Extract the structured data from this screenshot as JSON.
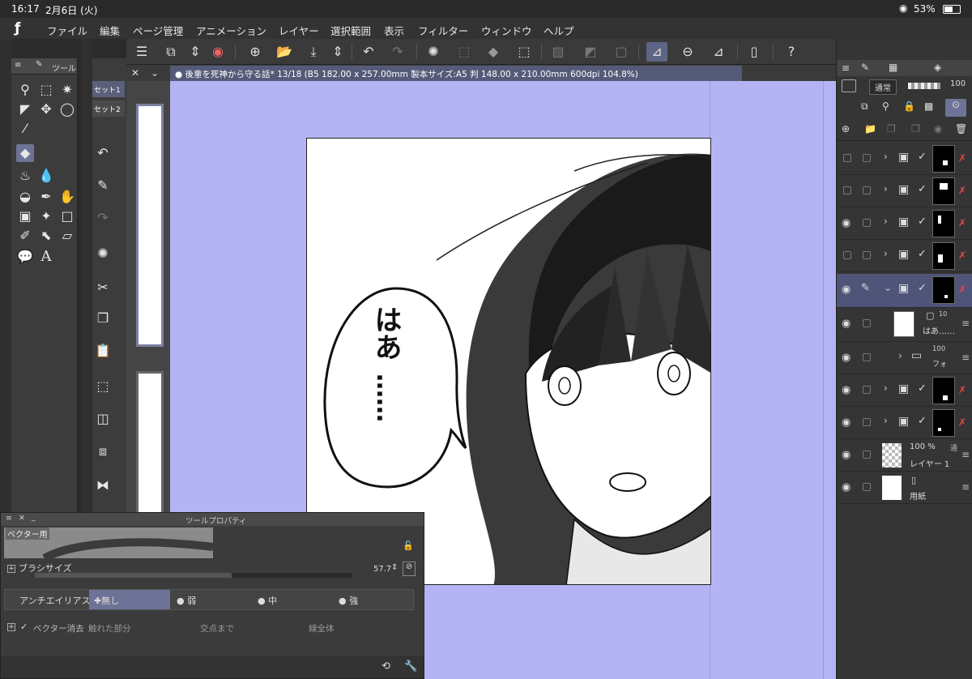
{
  "status": {
    "time": "16:17",
    "date": "2月6日 (火)",
    "battery": "53%"
  },
  "menu": {
    "logo": "ƒ",
    "items": [
      "ファイル",
      "編集",
      "ページ管理",
      "アニメーション",
      "レイヤー",
      "選択範囲",
      "表示",
      "フィルター",
      "ウィンドウ",
      "ヘルプ"
    ]
  },
  "toolpalette": {
    "title": "ツール"
  },
  "subtool": {
    "tab1": "セット1",
    "tab2": "セット2"
  },
  "document": {
    "tab_title": "後輩を死神から守る話* 13/18 (B5 182.00 x 257.00mm 製本サイズ:A5 判 148.00 x 210.00mm 600dpi 104.8%)"
  },
  "canvas": {
    "speech_line1": "はあ",
    "speech_dots": "……",
    "background_color": "#b4b4f4"
  },
  "layers": {
    "blend_mode": "通常",
    "opacity": "100",
    "rows": [
      {
        "visible": false,
        "selected": false,
        "type": "frame"
      },
      {
        "visible": false,
        "selected": false,
        "type": "frame"
      },
      {
        "visible": true,
        "selected": false,
        "type": "frame"
      },
      {
        "visible": false,
        "selected": false,
        "type": "frame"
      },
      {
        "visible": true,
        "selected": true,
        "type": "frame"
      }
    ],
    "sub_text_name": "はあ……",
    "sub_text_pct": "10",
    "folder_pct": "100",
    "folder_name": "フォ",
    "lower_rows": [
      {
        "visible": true,
        "type": "frame"
      },
      {
        "visible": true,
        "type": "frame"
      }
    ],
    "layer1_opacity": "100 %",
    "layer1_mode": "通",
    "layer1_name": "レイヤー 1",
    "paper_name": "用紙"
  },
  "toolprop": {
    "title": "ツールプロパティ",
    "preset": "ベクター用",
    "brush_size_label": "ブラシサイズ",
    "brush_size_value": "57.7",
    "brush_size_fraction": 0.62,
    "antialias_label": "アンチエイリアス",
    "antialias_options": [
      "無し",
      "弱",
      "中",
      "強"
    ],
    "antialias_selected": 0,
    "vector_erase_label": "ベクター消去",
    "vector_erase_options": [
      "触れた部分",
      "交点まで",
      "線全体"
    ]
  },
  "icons": [
    "pencil-icon",
    "eraser-icon",
    "undo-icon",
    "redo-icon",
    "save-icon",
    "eye-icon",
    "lock-icon",
    "trash-icon",
    "question-icon",
    "menu-icon"
  ]
}
